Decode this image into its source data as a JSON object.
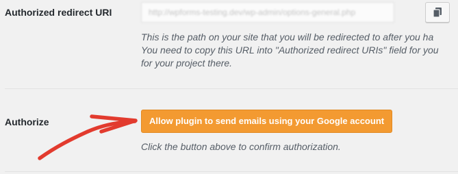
{
  "redirect": {
    "label": "Authorized redirect URI",
    "url_value": "http://wpforms-testing.dev/wp-admin/options-general.php",
    "copy_icon": "copy-icon",
    "description_lines": [
      "This is the path on your site that you will be redirected to after you ha",
      "You need to copy this URL into \"Authorized redirect URIs\" field for you",
      "for your project there."
    ]
  },
  "authorize": {
    "label": "Authorize",
    "button_label": "Allow plugin to send emails using your Google account",
    "help_text": "Click the button above to confirm authorization.",
    "annotation_icon": "red-arrow-annotation"
  },
  "colors": {
    "accent": "#f39a31",
    "arrow": "#e23b2e",
    "background": "#f1f1f1"
  }
}
